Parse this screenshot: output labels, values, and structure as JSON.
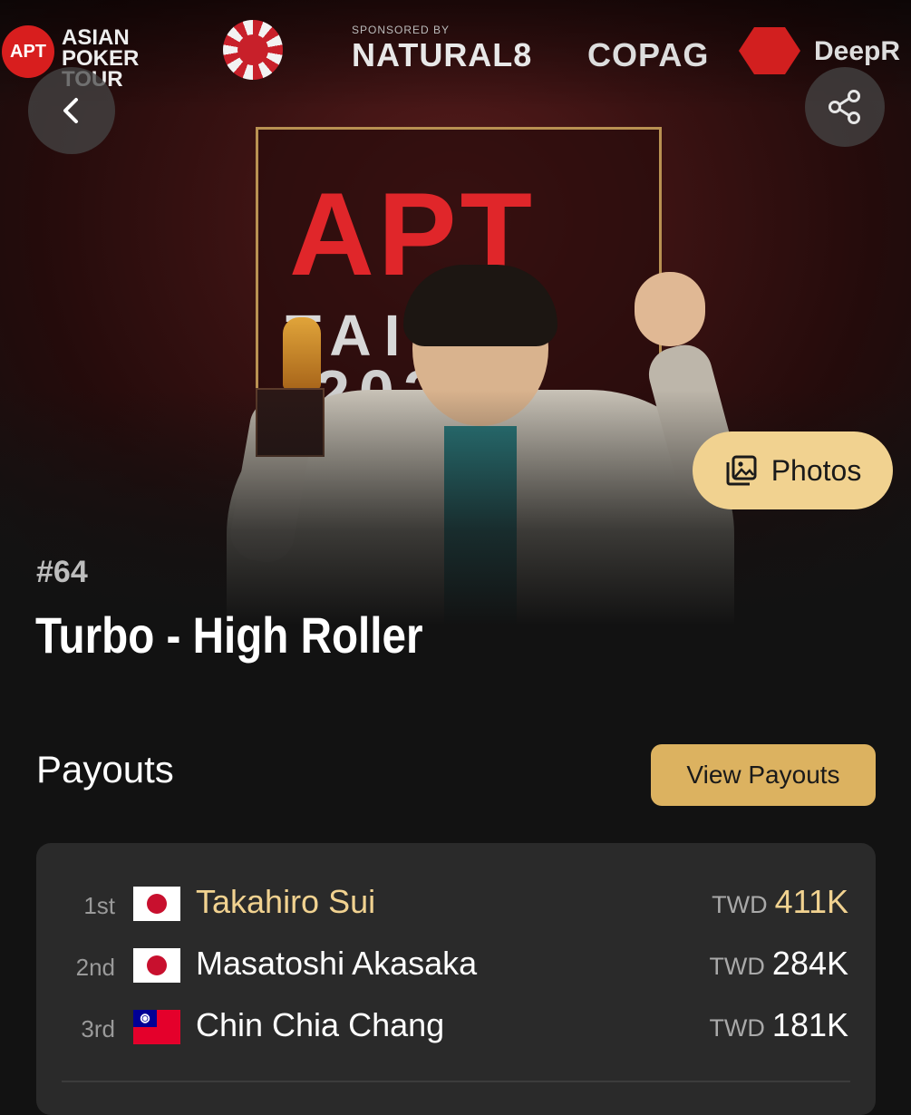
{
  "sponsors": {
    "apt_short": "APT",
    "apt_full_lines": [
      "ASIAN",
      "POKER",
      "TOUR"
    ],
    "sponsored_by": "SPONSORED BY",
    "natural8": "NATURAL8",
    "copag": "COPAG",
    "deep": "DeepR"
  },
  "banner": {
    "title": "APT",
    "subtitle": "TAIPEI",
    "year": "2026"
  },
  "hero": {
    "photos_label": "Photos",
    "back_icon": "chevron-left-icon",
    "share_icon": "share-icon",
    "photos_icon": "gallery-icon"
  },
  "event": {
    "number": "#64",
    "title": "Turbo - High Roller"
  },
  "payouts": {
    "title": "Payouts",
    "view_button": "View Payouts",
    "rows": [
      {
        "place": "1st",
        "flag": "japan",
        "name": "Takahiro Sui",
        "currency": "TWD",
        "amount": "411K",
        "highlight": true
      },
      {
        "place": "2nd",
        "flag": "japan",
        "name": "Masatoshi Akasaka",
        "currency": "TWD",
        "amount": "284K",
        "highlight": false
      },
      {
        "place": "3rd",
        "flag": "taiwan",
        "name": "Chin Chia Chang",
        "currency": "TWD",
        "amount": "181K",
        "highlight": false
      }
    ]
  },
  "colors": {
    "accent_gold": "#f1d290",
    "button_gold": "#dcb260",
    "background": "#121212",
    "card": "#2a2a2a"
  }
}
